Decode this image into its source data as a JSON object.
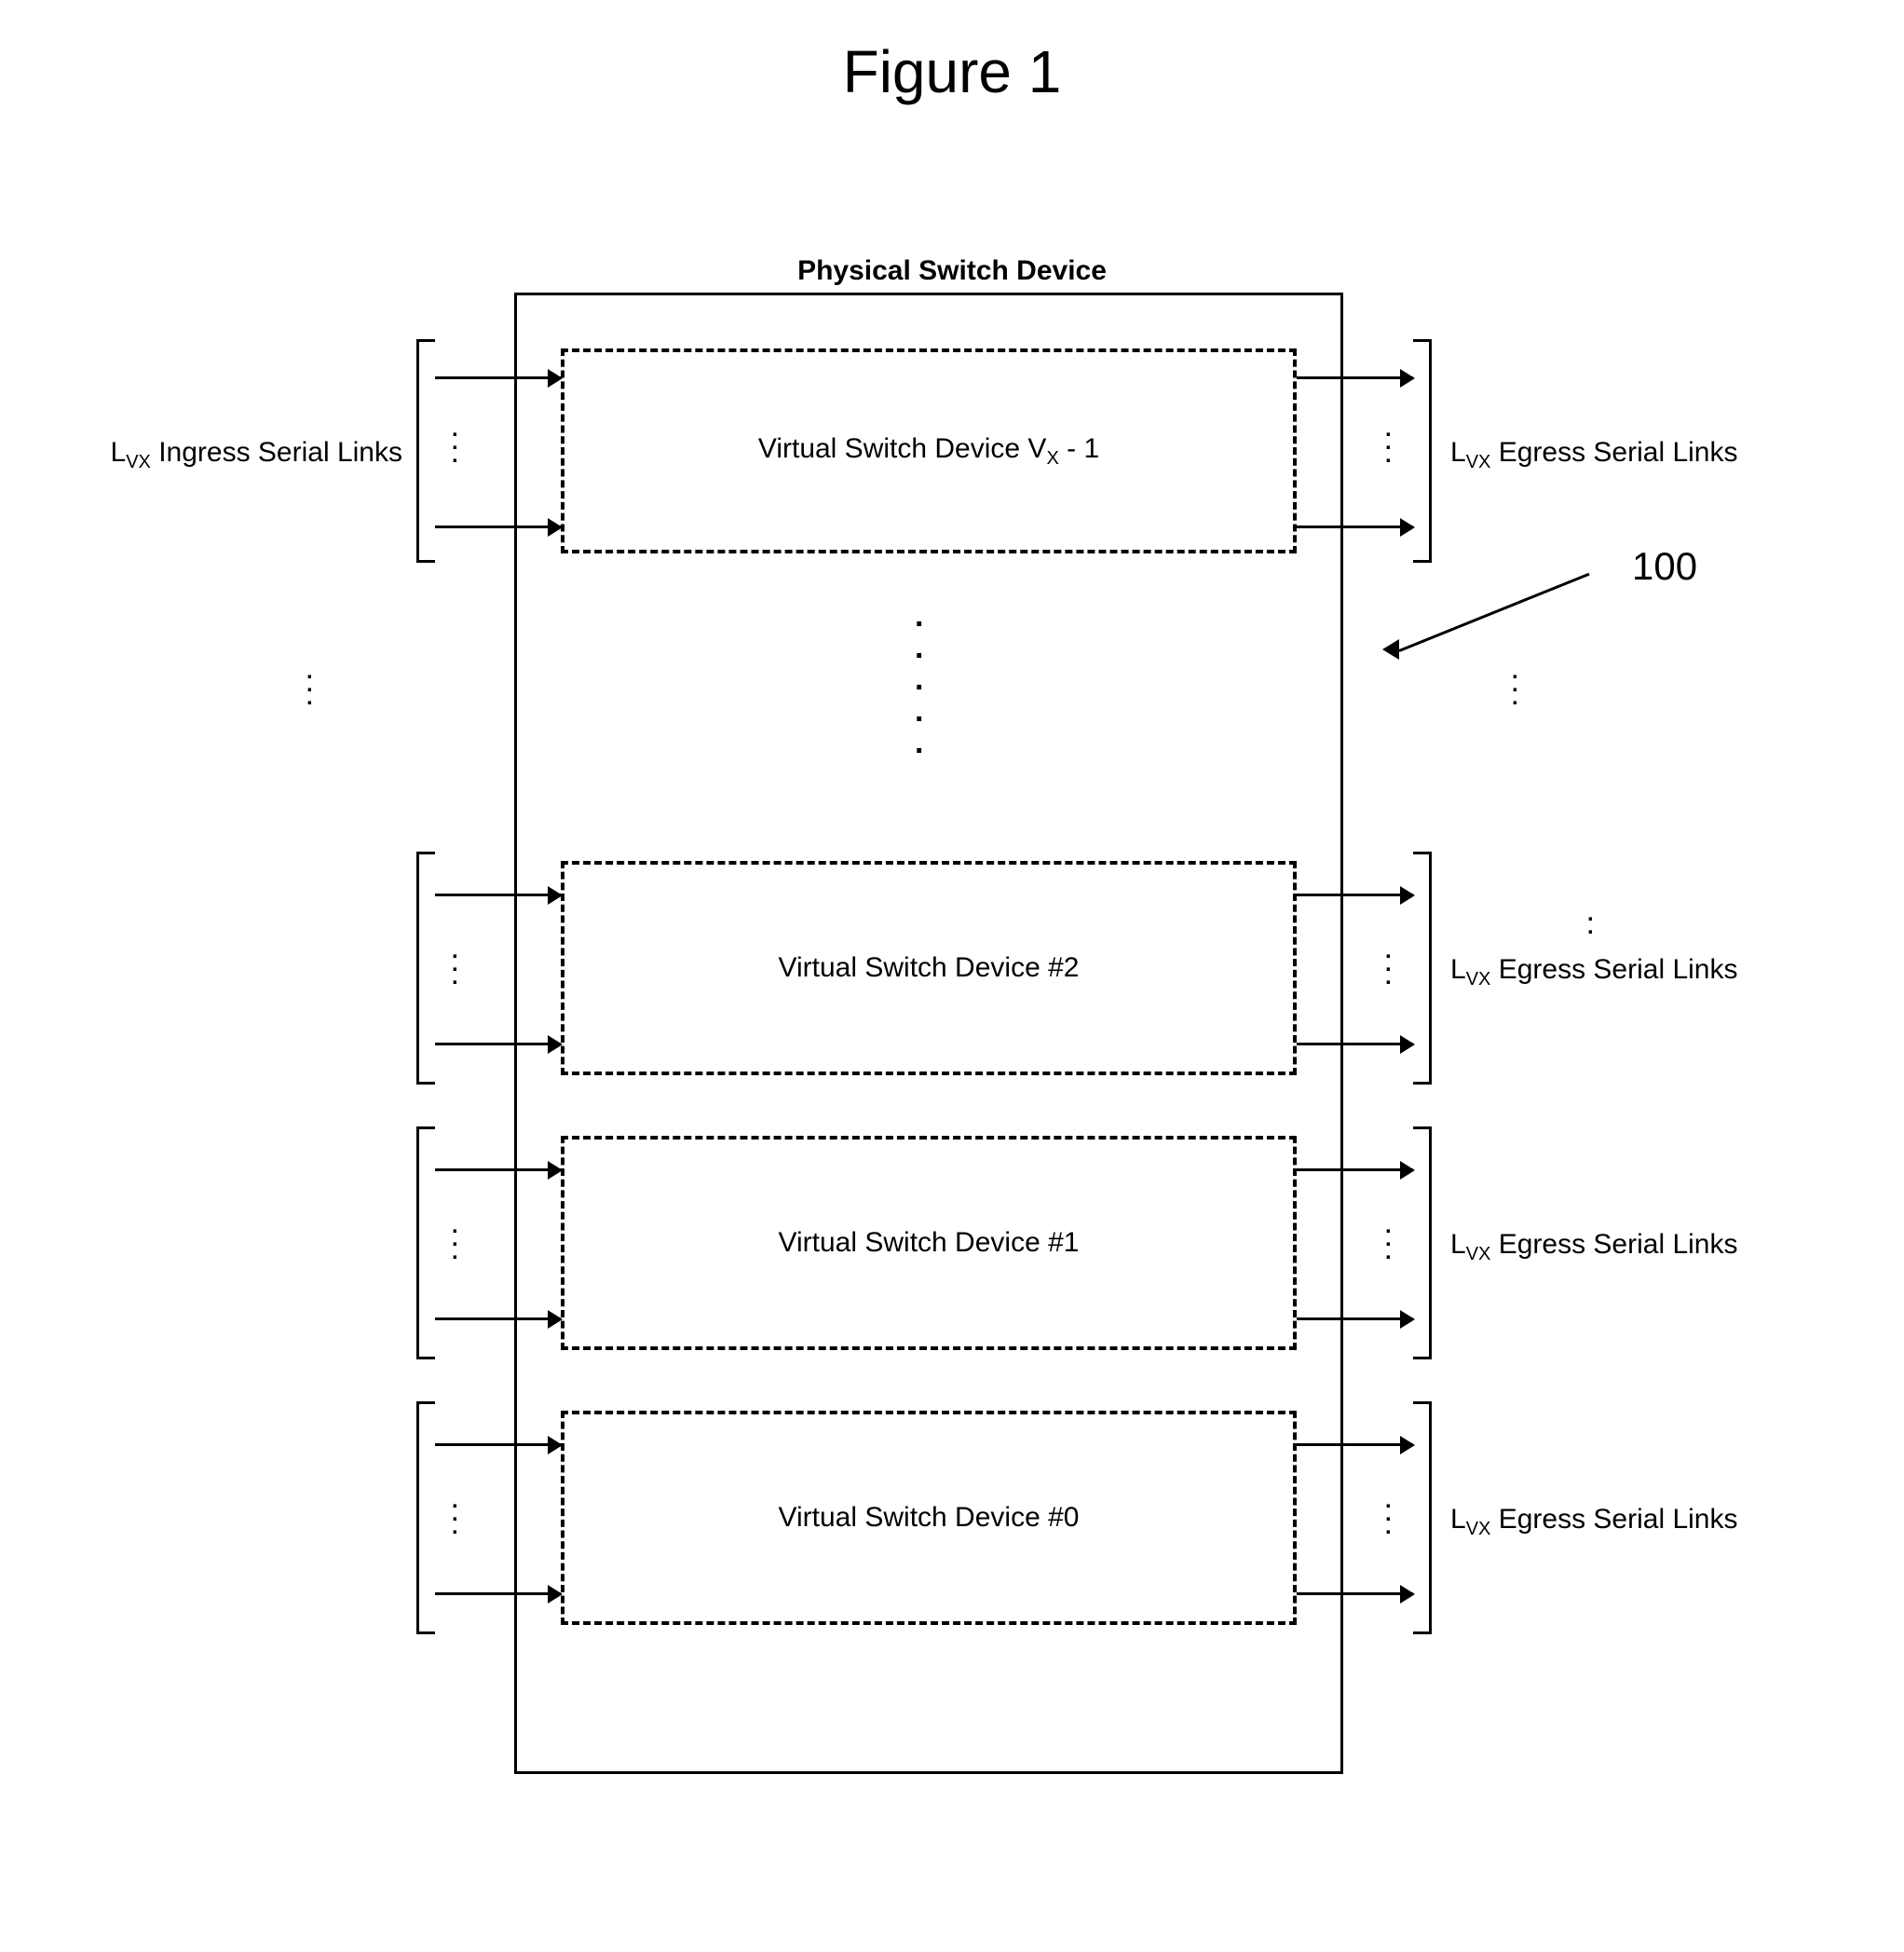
{
  "figure_title": "Figure 1",
  "device_title": "Physical Switch Device",
  "ingress_label": "L",
  "ingress_sub": "VX",
  "ingress_tail": " Ingress Serial Links",
  "egress_label": "L",
  "egress_sub": "VX",
  "egress_tail": " Egress Serial Links",
  "vsd_top_prefix": "Virtual Switch Device V",
  "vsd_top_sub": "X",
  "vsd_top_suffix": " - 1",
  "vsd2": "Virtual Switch Device #2",
  "vsd1": "Virtual Switch Device #1",
  "vsd0": "Virtual Switch Device #0",
  "callout": "100"
}
